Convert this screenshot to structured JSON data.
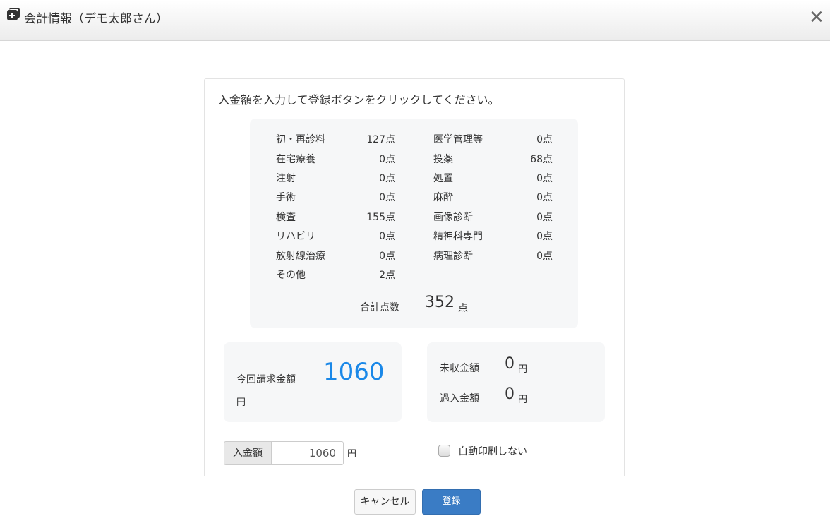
{
  "dialog": {
    "title": "会計情報（デモ太郎さん）",
    "close_label": "✕"
  },
  "instruction": "入金額を入力して登録ボタンをクリックしてください。",
  "scores": {
    "left": [
      {
        "label": "初・再診料",
        "value": "127点"
      },
      {
        "label": "在宅療養",
        "value": "0点"
      },
      {
        "label": "注射",
        "value": "0点"
      },
      {
        "label": "手術",
        "value": "0点"
      },
      {
        "label": "検査",
        "value": "155点"
      },
      {
        "label": "リハビリ",
        "value": "0点"
      },
      {
        "label": "放射線治療",
        "value": "0点"
      },
      {
        "label": "その他",
        "value": "2点"
      }
    ],
    "right": [
      {
        "label": "医学管理等",
        "value": "0点"
      },
      {
        "label": "投薬",
        "value": "68点"
      },
      {
        "label": "処置",
        "value": "0点"
      },
      {
        "label": "麻酔",
        "value": "0点"
      },
      {
        "label": "画像診断",
        "value": "0点"
      },
      {
        "label": "精神科専門",
        "value": "0点"
      },
      {
        "label": "病理診断",
        "value": "0点"
      }
    ],
    "total_label": "合計点数",
    "total_value": "352",
    "total_unit": "点"
  },
  "billing": {
    "label": "今回請求金額",
    "value": "1060",
    "unit": "円"
  },
  "other": {
    "unpaid_label": "未収金額",
    "unpaid_value": "0",
    "unpaid_unit": "円",
    "overpaid_label": "過入金額",
    "overpaid_value": "0",
    "overpaid_unit": "円"
  },
  "payment": {
    "addon_label": "入金額",
    "input_value": "1060",
    "unit": "円"
  },
  "auto_print": {
    "label": "自動印刷しない",
    "checked": false
  },
  "footer": {
    "cancel_label": "キャンセル",
    "submit_label": "登録"
  },
  "colors": {
    "accent": "#1a88e8",
    "primary_button": "#3a7cc5"
  }
}
